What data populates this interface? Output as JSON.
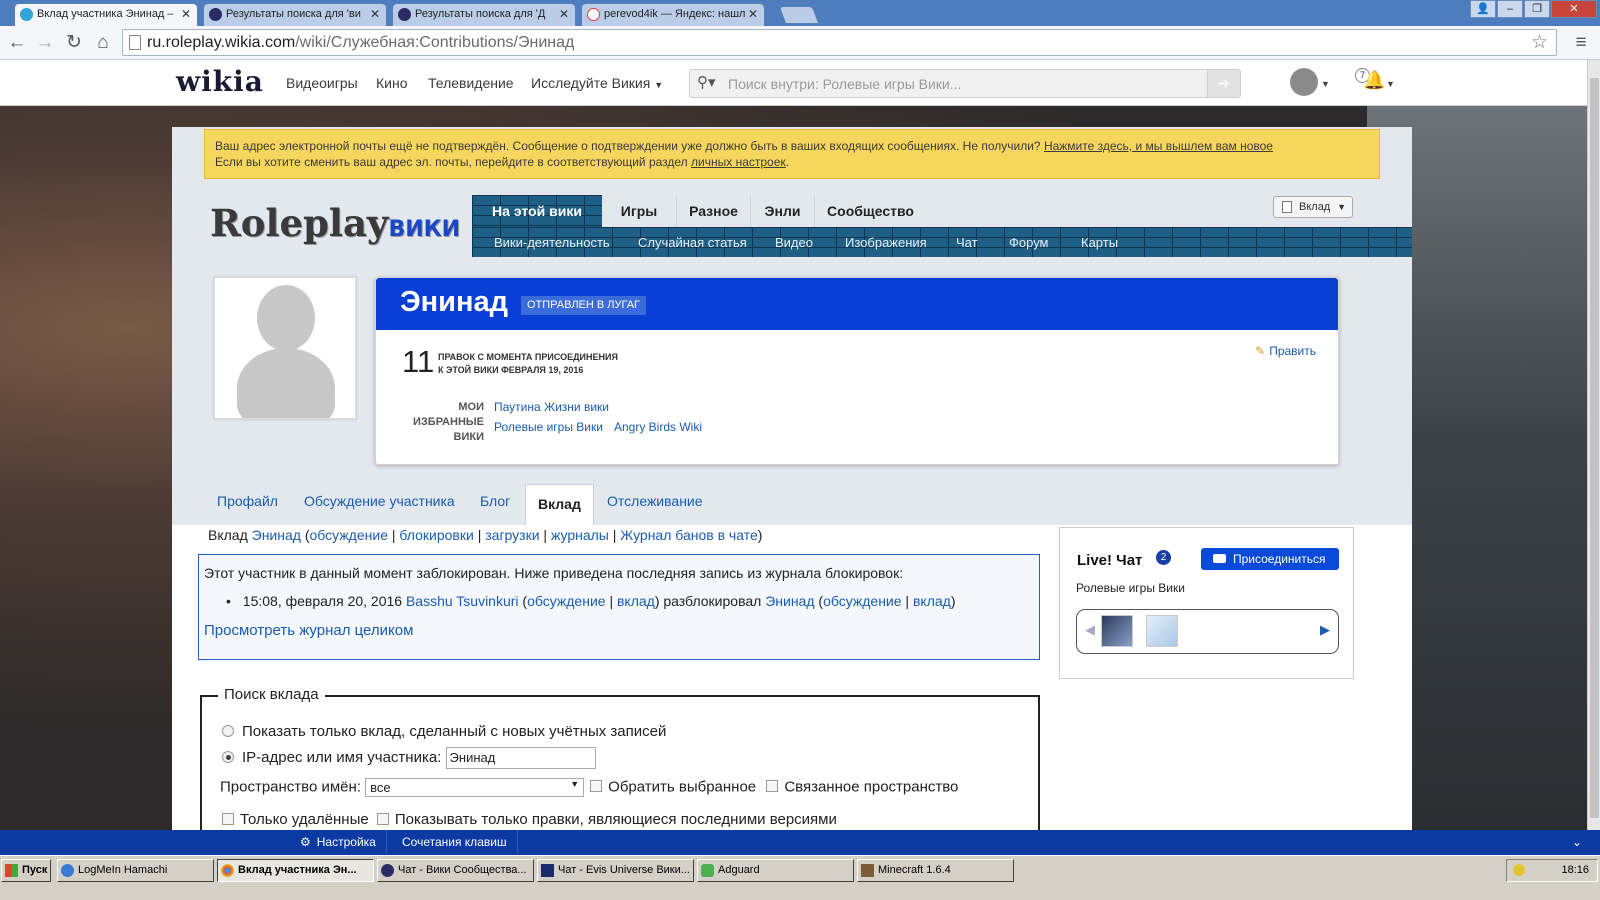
{
  "browser": {
    "tabs": [
      {
        "title": "Вклад участника Энинад –",
        "active": true
      },
      {
        "title": "Результаты поиска для 'ви",
        "active": false
      },
      {
        "title": "Результаты поиска для 'Д",
        "active": false
      },
      {
        "title": "perevod4ik — Яндекс: нашл",
        "active": false
      }
    ],
    "url_host": "ru.roleplay.wikia.com",
    "url_path": "/wiki/Служебная:Contributions/Энинад"
  },
  "global_nav": {
    "logo": "wikia",
    "links": [
      "Видеоигры",
      "Кино",
      "Телевидение",
      "Исследуйте Викия"
    ],
    "search_placeholder": "Поиск внутри: Ролевые игры Вики...",
    "notif_count": "7"
  },
  "notice": {
    "text": "Ваш адрес электронной почты ещё не подтверждён. Сообщение о подтверждении уже должно быть в ваших входящих сообщениях. Не получили?",
    "link1": "Нажмите здесь, и мы вышлем вам новое",
    "text2": "Если вы хотите сменить ваш адрес эл. почты, перейдите в соответствующий раздел",
    "link2": "личных настроек",
    "tail": "."
  },
  "wiki": {
    "logo_main": "Roleplay",
    "logo_sub": "ВИКИ",
    "tabs": [
      "На этой вики",
      "Игры",
      "Разное",
      "Энли",
      "Сообщество"
    ],
    "subnav": [
      "Вики-деятельность",
      "Случайная статья",
      "Видео",
      "Изображения",
      "Чат",
      "Форум",
      "Карты"
    ],
    "contrib_button": "Вклад"
  },
  "masthead": {
    "username": "Энинад",
    "badge": "отправлен в ЛУГАГ",
    "edit_count": "11",
    "edit_label_1": "правок с момента присоединения",
    "edit_label_2": "к этой вики февраля 19, 2016",
    "edit_link": "Править",
    "favs_label_1": "Мои",
    "favs_label_2": "избранные",
    "favs_label_3": "вики",
    "favs": [
      "Паутина Жизни вики",
      "Ролевые игры Вики",
      "Angry Birds Wiki"
    ]
  },
  "profile_tabs": [
    "Профайл",
    "Обсуждение участника",
    "Блог",
    "Вклад",
    "Отслеживание"
  ],
  "crumbs": {
    "prefix": "Вклад",
    "user": "Энинад",
    "open": " (",
    "links": [
      "обсуждение",
      "блокировки",
      "загрузки",
      "журналы",
      "Журнал банов в чате"
    ],
    "sep": " | ",
    "close": ")"
  },
  "block": {
    "message": "Этот участник в данный момент заблокирован. Ниже приведена последняя запись из журнала блокировок:",
    "entry_time": "15:08, февраля 20, 2016",
    "entry_admin": "Basshu Tsuvinkuri",
    "open": " (",
    "talk": "обсуждение",
    "sep": " | ",
    "contribs": "вклад",
    "close": ")",
    "action": ") разблокировал",
    "target": "Энинад",
    "view_log": "Просмотреть журнал целиком"
  },
  "chat": {
    "title": "Live! Чат",
    "count": "2",
    "join": "Присоединиться",
    "wiki_name": "Ролевые игры Вики"
  },
  "search_form": {
    "legend": "Поиск вклада",
    "option_new": "Показать только вклад, сделанный с новых учётных записей",
    "option_user": "IP-адрес или имя участника:",
    "user_value": "Энинад",
    "namespace_label": "Пространство имён:",
    "namespace_value": "все",
    "invert": "Обратить выбранное",
    "associated": "Связанное пространство",
    "deleted_only": "Только удалённые",
    "top_only": "Показывать только правки, являющиеся последними версиями"
  },
  "toolbar": {
    "settings": "Настройка",
    "shortcuts": "Сочетания клавиш"
  },
  "taskbar": {
    "start": "Пуск",
    "buttons": [
      "LogMeIn Hamachi",
      "Вклад участника Эн...",
      "Чат - Вики Сообщества...",
      "Чат - Evis Universe Вики...",
      "Adguard",
      "Minecraft 1.6.4"
    ],
    "clock": "18:16"
  }
}
